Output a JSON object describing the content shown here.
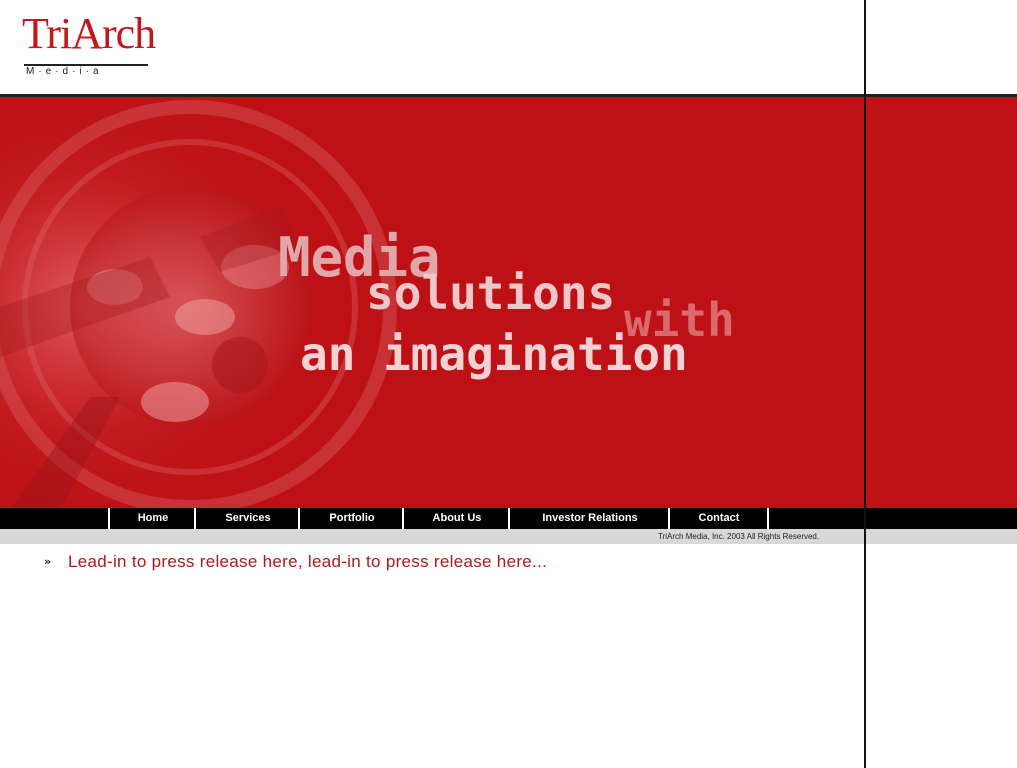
{
  "brand": {
    "name": "TriArch",
    "sub": "M·e·d·i·a"
  },
  "hero": {
    "line_media": "Media",
    "line_solutions": "solutions",
    "line_with": "with",
    "line_imagination": "an imagination"
  },
  "nav": {
    "items": [
      "Home",
      "Services",
      "Portfolio",
      "About Us",
      "Investor Relations",
      "Contact"
    ]
  },
  "footer": {
    "copyright": "TriArch Media, Inc.  2003   All Rights Reserved."
  },
  "press": {
    "bullet": "»",
    "text": "Lead-in to press release here, lead-in to press release here..."
  },
  "colors": {
    "brand_red": "#bd1115",
    "text_red": "#b1171b",
    "nav_bg": "#000000",
    "footer_bg": "#d8d8d8"
  }
}
